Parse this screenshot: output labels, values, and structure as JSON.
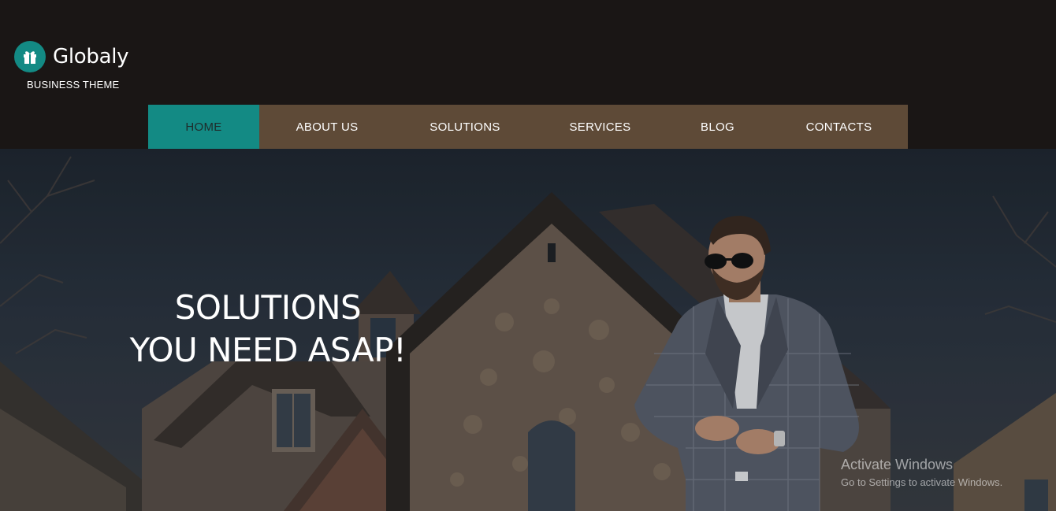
{
  "brand": {
    "name": "Globaly",
    "tagline": "BUSINESS THEME",
    "icon": "gift-icon",
    "accent_color": "#138a84"
  },
  "nav": {
    "background_color": "#5e4a37",
    "items": [
      {
        "label": "HOME",
        "active": true
      },
      {
        "label": "ABOUT US",
        "active": false
      },
      {
        "label": "SOLUTIONS",
        "active": false
      },
      {
        "label": "SERVICES",
        "active": false
      },
      {
        "label": "BLOG",
        "active": false
      },
      {
        "label": "CONTACTS",
        "active": false
      }
    ]
  },
  "hero": {
    "heading_line1": "SOLUTIONS",
    "heading_line2": "YOU NEED ASAP!",
    "image": "house-with-businessman-photo"
  },
  "watermark": {
    "title": "Activate Windows",
    "subtitle": "Go to Settings to activate Windows."
  }
}
